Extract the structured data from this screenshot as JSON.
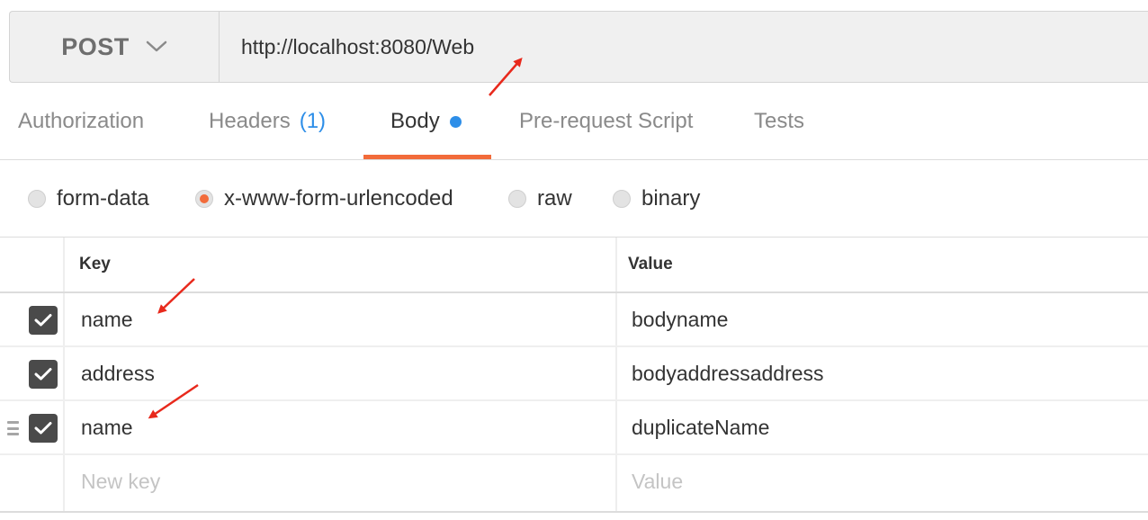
{
  "request": {
    "method": "POST",
    "url": "http://localhost:8080/Web"
  },
  "tabs": [
    {
      "label": "Authorization"
    },
    {
      "label": "Headers",
      "count": "(1)"
    },
    {
      "label": "Body",
      "active": true
    },
    {
      "label": "Pre-request Script"
    },
    {
      "label": "Tests"
    }
  ],
  "body_types": [
    {
      "label": "form-data",
      "selected": false
    },
    {
      "label": "x-www-form-urlencoded",
      "selected": true
    },
    {
      "label": "raw",
      "selected": false
    },
    {
      "label": "binary",
      "selected": false
    }
  ],
  "params_table": {
    "headers": {
      "key": "Key",
      "value": "Value"
    },
    "rows": [
      {
        "key": "name",
        "value": "bodyname",
        "checked": true
      },
      {
        "key": "address",
        "value": "bodyaddressaddress",
        "checked": true
      },
      {
        "key": "name",
        "value": "duplicateName",
        "checked": true
      }
    ],
    "new_row": {
      "key_placeholder": "New key",
      "value_placeholder": "Value"
    }
  },
  "colors": {
    "accent": "#f26b3a",
    "link_blue": "#2d8ee8",
    "annotation_arrow": "#e8291c"
  },
  "icons": {
    "method_dropdown": "chevron-down-icon",
    "checkbox": "checkmark-icon",
    "row_handle": "drag-handle-icon",
    "annotation": "red-arrow-annotation"
  }
}
